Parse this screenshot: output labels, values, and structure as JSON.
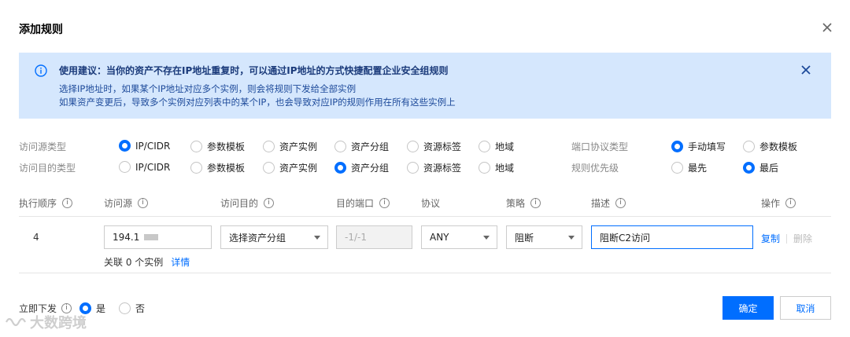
{
  "dialog": {
    "title": "添加规则"
  },
  "info": {
    "headline": "使用建议：当你的资产不存在IP地址重复时，可以通过IP地址的方式快捷配置企业安全组规则",
    "line1": "选择IP地址时，如果某个IP地址对应多个实例，则会将规则下发给全部实例",
    "line2": "如果资产变更后，导致多个实例对应列表中的某个IP，也会导致对应IP的规则作用在所有这些实例上"
  },
  "source_type": {
    "label": "访问源类型",
    "options": [
      "IP/CIDR",
      "参数模板",
      "资产实例",
      "资产分组",
      "资源标签",
      "地域"
    ],
    "selected": "IP/CIDR"
  },
  "dest_type": {
    "label": "访问目的类型",
    "options": [
      "IP/CIDR",
      "参数模板",
      "资产实例",
      "资产分组",
      "资源标签",
      "地域"
    ],
    "selected": "资产分组"
  },
  "port_protocol_type": {
    "label": "端口协议类型",
    "options": [
      "手动填写",
      "参数模板"
    ],
    "selected": "手动填写"
  },
  "rule_priority": {
    "label": "规则优先级",
    "options": [
      "最先",
      "最后"
    ],
    "selected": "最后"
  },
  "table": {
    "headers": {
      "order": "执行顺序",
      "source": "访问源",
      "destination": "访问目的",
      "dest_port": "目的端口",
      "protocol": "协议",
      "policy": "策略",
      "description": "描述",
      "actions": "操作"
    },
    "row": {
      "order": "4",
      "source_value": "194.1",
      "destination_value": "选择资产分组",
      "dest_port_value": "-1/-1",
      "protocol_value": "ANY",
      "policy_value": "阻断",
      "description_value": "阻断C2访问",
      "assoc_text": "关联 0 个实例",
      "assoc_link": "详情",
      "copy": "复制",
      "delete": "删除"
    }
  },
  "footer": {
    "immediate_label": "立即下发",
    "yes": "是",
    "no": "否",
    "immediate_selected": "是",
    "confirm": "确定",
    "cancel": "取消"
  },
  "watermark": "大数跨境",
  "colors": {
    "primary": "#006eff",
    "info_bg": "#d5e7fd"
  }
}
